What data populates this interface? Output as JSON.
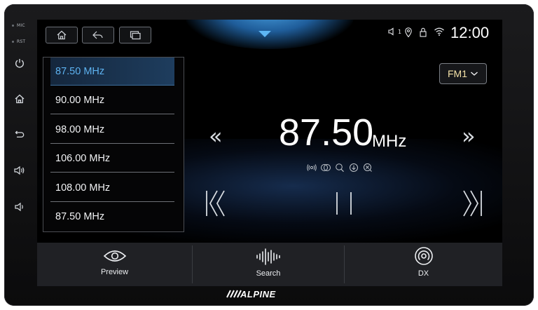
{
  "side_panel": {
    "mic_label": "MIC",
    "rst_label": "RST",
    "buttons": [
      {
        "icon": "power-icon"
      },
      {
        "icon": "home-icon"
      },
      {
        "icon": "back-icon"
      },
      {
        "icon": "volume-up-icon"
      },
      {
        "icon": "volume-down-icon"
      }
    ]
  },
  "top_bar": {
    "buttons": [
      {
        "icon": "home-icon"
      },
      {
        "icon": "back-icon"
      },
      {
        "icon": "multitask-icon"
      }
    ],
    "status": {
      "volume_level": "1",
      "icons": [
        "volume-icon",
        "location-icon",
        "lock-icon",
        "wifi-icon"
      ],
      "clock": "12:00"
    },
    "dropdown_icon": "chevron-down-icon"
  },
  "preset_list": [
    {
      "label": "87.50 MHz",
      "active": true
    },
    {
      "label": "90.00 MHz",
      "active": false
    },
    {
      "label": "98.00 MHz",
      "active": false
    },
    {
      "label": "106.00 MHz",
      "active": false
    },
    {
      "label": "108.00 MHz",
      "active": false
    },
    {
      "label": "87.50 MHz",
      "active": false
    }
  ],
  "band_selector": {
    "label": "FM1"
  },
  "tuner": {
    "frequency": "87.50",
    "unit": "MHz",
    "seek_prev_glyph": "«",
    "seek_next_glyph": "»",
    "feature_icons": [
      "broadcast-icon",
      "stereo-icon",
      "search-icon",
      "download-icon",
      "scan-icon"
    ]
  },
  "bottom_bar": {
    "items": [
      {
        "label": "Preview",
        "icon": "eye-icon"
      },
      {
        "label": "Search",
        "icon": "waveform-icon"
      },
      {
        "label": "DX",
        "icon": "target-icon"
      }
    ]
  },
  "brand": {
    "logo_text": "ALPINE"
  },
  "colors": {
    "accent": "#5db2f0",
    "band_text": "#f5e3a8",
    "background": "#000000"
  }
}
